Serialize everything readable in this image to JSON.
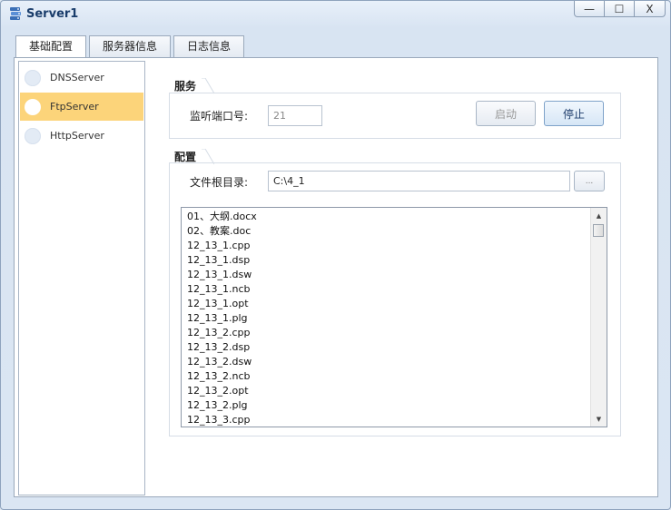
{
  "window": {
    "title": "Server1"
  },
  "controls": {
    "minimize": "—",
    "maximize": "☐",
    "close": "X"
  },
  "tabs": [
    {
      "label": "基础配置"
    },
    {
      "label": "服务器信息"
    },
    {
      "label": "日志信息"
    }
  ],
  "sidebar": {
    "items": [
      {
        "label": "DNSServer",
        "selected": false
      },
      {
        "label": "FtpServer",
        "selected": true
      },
      {
        "label": "HttpServer",
        "selected": false
      }
    ]
  },
  "service": {
    "group_label": "服务",
    "port_label": "监听端口号:",
    "port_value": "21",
    "start_label": "启动",
    "stop_label": "停止"
  },
  "config": {
    "group_label": "配置",
    "root_label": "文件根目录:",
    "root_value": "C:\\4_1",
    "browse_label": "..."
  },
  "files": [
    "01、大纲.docx",
    "02、教案.doc",
    "12_13_1.cpp",
    "12_13_1.dsp",
    "12_13_1.dsw",
    "12_13_1.ncb",
    "12_13_1.opt",
    "12_13_1.plg",
    "12_13_2.cpp",
    "12_13_2.dsp",
    "12_13_2.dsw",
    "12_13_2.ncb",
    "12_13_2.opt",
    "12_13_2.plg",
    "12_13_3.cpp"
  ],
  "colors": {
    "selected_item": "#fcd47a",
    "window_bg": "#dbe6f3",
    "title_text": "#1a3d6b"
  }
}
